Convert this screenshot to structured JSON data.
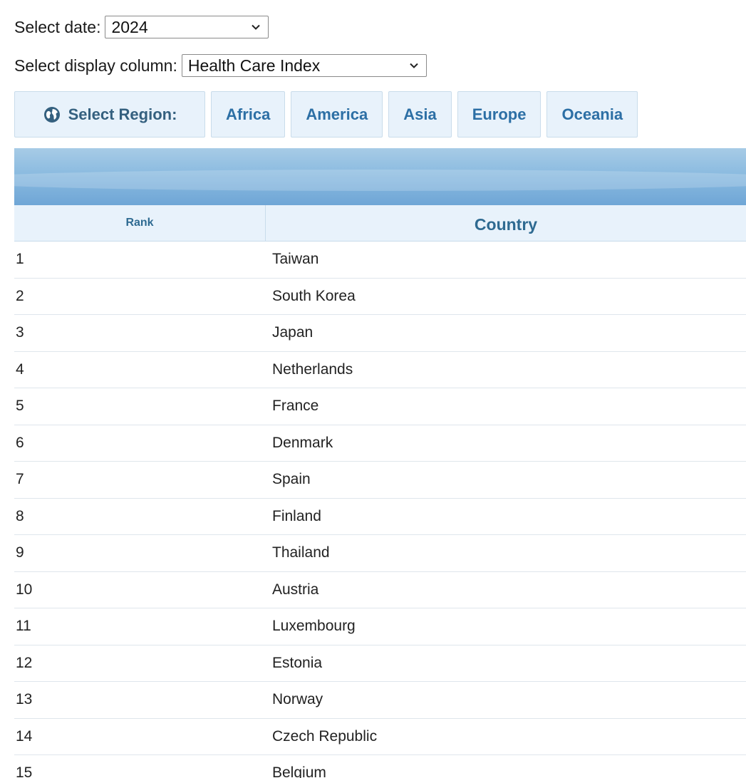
{
  "controls": {
    "date_label": "Select date:",
    "date_value": "2024",
    "column_label": "Select display column:",
    "column_value": "Health Care Index"
  },
  "region_bar": {
    "label": "Select Region:",
    "label_icon": "globe-icon",
    "regions": [
      "Africa",
      "America",
      "Asia",
      "Europe",
      "Oceania"
    ]
  },
  "table": {
    "headers": {
      "rank": "Rank",
      "country": "Country"
    },
    "rows": [
      {
        "rank": "1",
        "country": "Taiwan"
      },
      {
        "rank": "2",
        "country": "South Korea"
      },
      {
        "rank": "3",
        "country": "Japan"
      },
      {
        "rank": "4",
        "country": "Netherlands"
      },
      {
        "rank": "5",
        "country": "France"
      },
      {
        "rank": "6",
        "country": "Denmark"
      },
      {
        "rank": "7",
        "country": "Spain"
      },
      {
        "rank": "8",
        "country": "Finland"
      },
      {
        "rank": "9",
        "country": "Thailand"
      },
      {
        "rank": "10",
        "country": "Austria"
      },
      {
        "rank": "11",
        "country": "Luxembourg"
      },
      {
        "rank": "12",
        "country": "Estonia"
      },
      {
        "rank": "13",
        "country": "Norway"
      },
      {
        "rank": "14",
        "country": "Czech Republic"
      },
      {
        "rank": "15",
        "country": "Belgium"
      }
    ]
  },
  "colors": {
    "accent": "#2c6fa5",
    "header_bg": "#e8f2fb",
    "banner": "#8bbbe0"
  }
}
